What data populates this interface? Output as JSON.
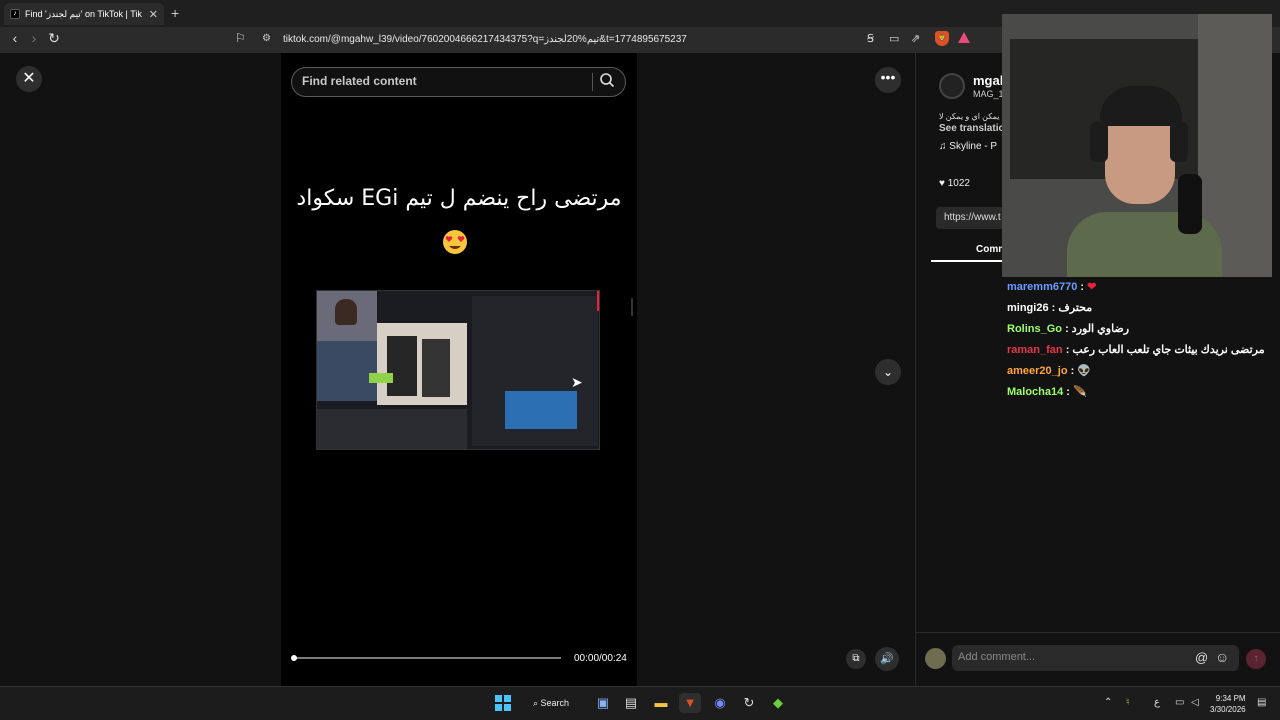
{
  "browser": {
    "tab_title": "Find 'تيم لجندز' on TikTok | Tik",
    "tab_close": "✕",
    "new_tab": "+",
    "url": "tiktok.com/@mgahw_l39/video/7602004666217434375?q=تيم%20لجندز&t=1774895675237",
    "nav": {
      "back": "‹",
      "forward": "›",
      "reload": "↻"
    }
  },
  "player": {
    "search_placeholder": "Find related content",
    "caption": "مرتضى راح ينضم ل تيم EGi سكواد",
    "time": "00:00/00:24",
    "progress": 0.0,
    "close": "✕",
    "more": "•••",
    "down": "⌄"
  },
  "sidebar": {
    "author_name": "mgal",
    "author_nick": "MAG_1",
    "description": "يمكن اي و يمكن لا",
    "see_translation": "See translatio",
    "music": "Skyline - P",
    "like_count": "1022",
    "link": "https://www.t",
    "comments_tab": "Comm"
  },
  "chat": [
    {
      "user": "maremm6770",
      "msg": "",
      "emoji": "❤",
      "color": "#6a9bff"
    },
    {
      "user": "mingi26",
      "msg": "محترف",
      "color": "#ffffff"
    },
    {
      "user": "Rolins_Go",
      "msg": "رضاوي الورد",
      "color": "#9cff6a"
    },
    {
      "user": "raman_fan",
      "msg": "مرتضى نريدك بيثات جاي تلعب العاب رعب",
      "color": "#e8344d"
    },
    {
      "user": "ameer20_jo",
      "msg": "",
      "emoji": "👽",
      "color": "#ffa63b"
    },
    {
      "user": "Malocha14",
      "msg": "",
      "emoji": "🪶",
      "color": "#9cff6a"
    }
  ],
  "composer": {
    "placeholder": "Add comment...",
    "at": "@",
    "emoji": "☺",
    "post": "↑"
  },
  "taskbar": {
    "search_label": "Search",
    "time": "9:34 PM",
    "date": "3/30/2026",
    "lang": "ع"
  }
}
